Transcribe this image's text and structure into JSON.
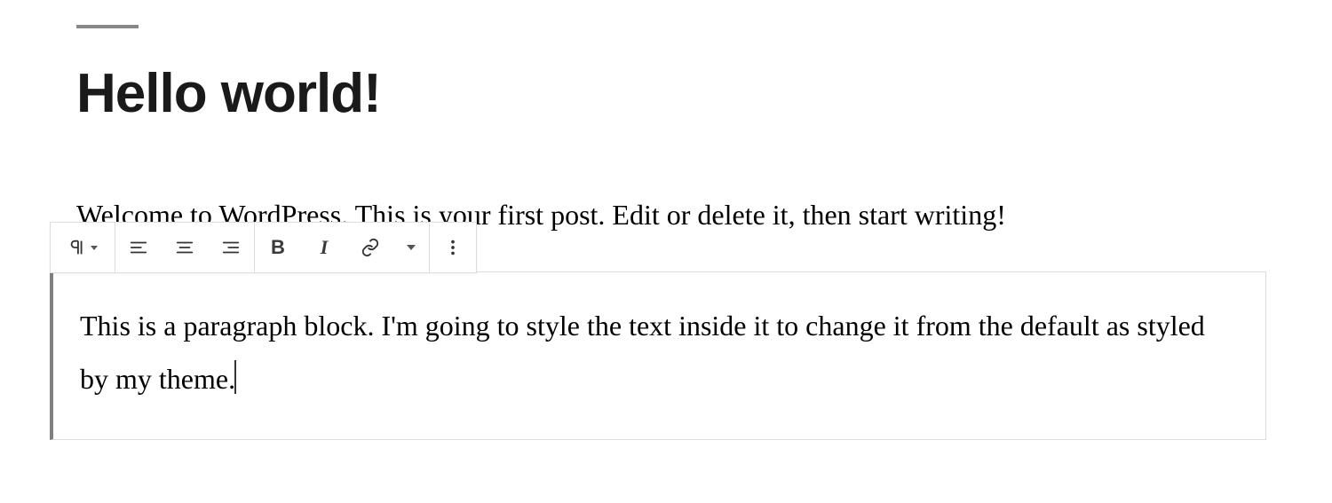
{
  "post": {
    "title": "Hello world!",
    "intro_paragraph": "Welcome to WordPress. This is your first post. Edit or delete it, then start writing!"
  },
  "toolbar": {
    "block_type_icon": "pilcrow-icon",
    "align": {
      "left": "align-left-icon",
      "center": "align-center-icon",
      "right": "align-right-icon"
    },
    "format": {
      "bold_label": "B",
      "italic_label": "I",
      "link_icon": "link-icon"
    },
    "more_icon": "more-vertical-icon"
  },
  "block": {
    "content": "This is a paragraph block. I'm going to style the text inside it to change it from the default as styled by my theme."
  }
}
